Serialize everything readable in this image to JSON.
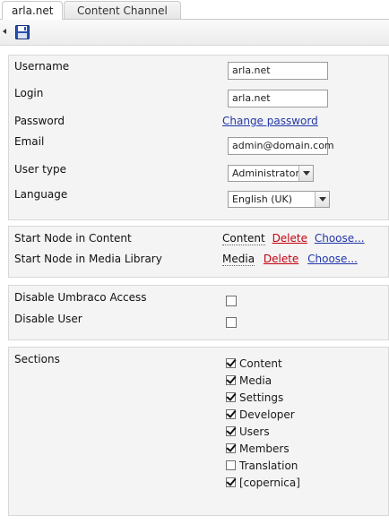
{
  "tabs": [
    {
      "label": "arla.net",
      "active": true
    },
    {
      "label": "Content Channel",
      "active": false
    }
  ],
  "toolbar": {
    "save_icon": "save-disk-icon"
  },
  "user": {
    "username_label": "Username",
    "username_value": "arla.net",
    "login_label": "Login",
    "login_value": "arla.net",
    "password_label": "Password",
    "change_password": "Change password",
    "email_label": "Email",
    "email_value": "admin@domain.com",
    "usertype_label": "User type",
    "usertype_value": "Administrator",
    "language_label": "Language",
    "language_value": "English (UK)"
  },
  "start_nodes": {
    "content_label": "Start Node in Content",
    "content_node": "Content",
    "media_label": "Start Node in Media Library",
    "media_node": "Media",
    "delete": "Delete",
    "choose": "Choose..."
  },
  "access": {
    "disable_umbraco_label": "Disable Umbraco Access",
    "disable_umbraco_checked": false,
    "disable_user_label": "Disable User",
    "disable_user_checked": false
  },
  "sections": {
    "label": "Sections",
    "items": [
      {
        "label": "Content",
        "checked": true
      },
      {
        "label": "Media",
        "checked": true
      },
      {
        "label": "Settings",
        "checked": true
      },
      {
        "label": "Developer",
        "checked": true
      },
      {
        "label": "Users",
        "checked": true
      },
      {
        "label": "Members",
        "checked": true
      },
      {
        "label": "Translation",
        "checked": false
      },
      {
        "label": "[copernica]",
        "checked": true
      }
    ]
  },
  "colors": {
    "link": "#2236a8",
    "delete_link": "#c4000f",
    "pane_bg": "#f4f4f4"
  }
}
